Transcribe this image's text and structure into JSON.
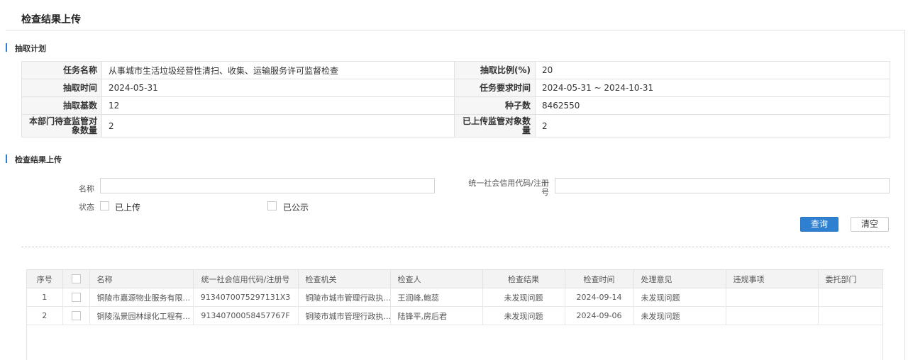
{
  "page": {
    "title": "检查结果上传"
  },
  "plan": {
    "section_title": "抽取计划",
    "task_name_label": "任务名称",
    "task_name": "从事城市生活垃圾经营性清扫、收集、运输服务许可监督检查",
    "ratio_label": "抽取比例(%)",
    "ratio": "20",
    "time_label": "抽取时间",
    "time": "2024-05-31",
    "req_time_label": "任务要求时间",
    "req_time": "2024-05-31 ~ 2024-10-31",
    "base_label": "抽取基数",
    "base": "12",
    "seed_label": "种子数",
    "seed": "8462550",
    "pending_label": "本部门待查监管对象数量",
    "pending": "2",
    "uploaded_label": "已上传监管对象数量",
    "uploaded": "2"
  },
  "upload": {
    "section_title": "检查结果上传",
    "name_label": "名称",
    "name_value": "",
    "credit_label": "统一社会信用代码/注册号",
    "credit_value": "",
    "status_label": "状态",
    "uploaded_option": "已上传",
    "published_option": "已公示",
    "query_button": "查询",
    "clear_button": "清空"
  },
  "grid": {
    "columns": [
      "序号",
      "",
      "名称",
      "统一社会信用代码/注册号",
      "检查机关",
      "检查人",
      "检查结果",
      "检查时间",
      "处理意见",
      "违规事项",
      "委托部门"
    ],
    "rows": [
      {
        "no": "1",
        "name": "铜陵市嘉源物业服务有限...",
        "code": "9134070075297131X3",
        "org": "铜陵市城市管理行政执...",
        "inspector": "王润峰,鲍蕊",
        "result": "未发现问题",
        "date": "2024-09-14",
        "opinion": "未发现问题",
        "violation": "",
        "dept": ""
      },
      {
        "no": "2",
        "name": "铜陵泓景园林绿化工程有...",
        "code": "91340700058457767F",
        "org": "铜陵市城市管理行政执...",
        "inspector": "陆锋平,房后君",
        "result": "未发现问题",
        "date": "2024-09-06",
        "opinion": "未发现问题",
        "violation": "",
        "dept": ""
      }
    ]
  }
}
